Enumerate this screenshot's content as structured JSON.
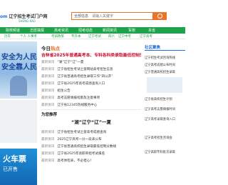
{
  "header": {
    "logo_text": "om",
    "logo_cn": "辽宁招生考试门户网",
    "logo_sub": "SHENG KAO",
    "search_select": "全部信息",
    "search_placeholder": "请输入关键字"
  },
  "nav_primary": [
    "院校频道",
    "志愿填报",
    "高考资讯",
    "招考动态",
    "新闻资讯",
    "军校",
    "本省"
  ],
  "nav_secondary": [
    "历年",
    "个人 人事考",
    "考研政策",
    "专升本",
    "辽宁考试",
    "四六",
    "辽宁中考",
    "辽宁高考"
  ],
  "banner": {
    "line1": "安全为人民",
    "line2": "安全靠人民"
  },
  "banner2": {
    "line1": "火车票",
    "line2": "已开售"
  },
  "today": {
    "title": "今日",
    "title_accent": "热点",
    "headline": "吉林省2025年普通高考本、专科各科类录取最低控制分数线",
    "items": [
      {
        "tag": "最新资讯",
        "text": "“湖”辽宁“辽”一夏"
      },
      {
        "tag": "最新资讯",
        "text": "辽宁省招生考试之窗网站高考招生信息"
      },
      {
        "tag": "最新资讯",
        "text": "辽宁省普通高考招生录取工作“四公开”"
      },
      {
        "tag": "最新资讯",
        "text": "辽宁省2025年高考成绩查询入口"
      },
      {
        "tag": "最新资讯",
        "text": "招生公告"
      },
      {
        "tag": "最新资讯",
        "text": "高考志愿填报指南及注意事项"
      },
      {
        "tag": "最新资讯",
        "text": "辽宁省12345热线服务中心"
      }
    ]
  },
  "hot": {
    "title": "为您推荐",
    "headline": "“湖”辽宁“辽”一夏",
    "items": [
      {
        "tag": "最新资讯",
        "text": "辽宁省招生考试之窗高考成绩查询"
      },
      {
        "tag": "最新资讯",
        "text": "2025辽宁高考一分一段表公布"
      },
      {
        "tag": "最新资讯",
        "text": "辽宁省普通高校招生录取最低控制分数线"
      },
      {
        "tag": "最新资讯",
        "text": "辽宁省2025年高职单招考试报名"
      },
      {
        "tag": "最新资讯",
        "text": "高考体检表，不必担心！"
      }
    ]
  },
  "right": {
    "title": "社区聚焦",
    "items": [
      "辽宁招生考试咨询热线",
      "辽宁高考成绩公布时间",
      "辽宁普通高校招生录取",
      "辽宁省高校招生计划",
      "辽宁高考志愿填报时间",
      "辽宁高考录取查询入口",
      "辽宁高考招生咨询会",
      "辽宁高职专科批次录取"
    ]
  }
}
